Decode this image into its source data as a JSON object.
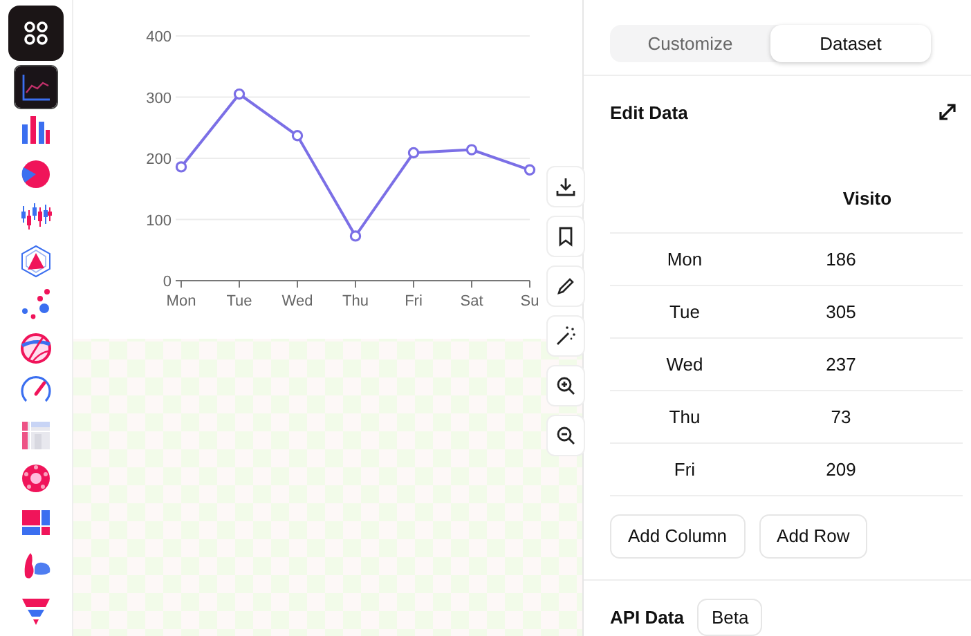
{
  "sidebar": {
    "items": [
      {
        "kind": "line",
        "selected": true
      },
      {
        "kind": "bar",
        "selected": false
      },
      {
        "kind": "pie",
        "selected": false
      },
      {
        "kind": "candlestick",
        "selected": false
      },
      {
        "kind": "radar",
        "selected": false
      },
      {
        "kind": "scatter",
        "selected": false
      },
      {
        "kind": "globe",
        "selected": false
      },
      {
        "kind": "gauge",
        "selected": false
      },
      {
        "kind": "grid",
        "selected": false
      },
      {
        "kind": "flower",
        "selected": false
      },
      {
        "kind": "treemap",
        "selected": false
      },
      {
        "kind": "blob",
        "selected": false
      },
      {
        "kind": "funnel",
        "selected": false
      }
    ]
  },
  "chart": {
    "chart_data": {
      "type": "line",
      "grid": true,
      "categories": [
        "Mon",
        "Tue",
        "Wed",
        "Thu",
        "Fri",
        "Sat",
        "Su"
      ],
      "ylim": [
        0,
        400
      ],
      "yticks": [
        0,
        100,
        200,
        300,
        400
      ],
      "series": [
        {
          "color": "#7b6fe6",
          "marker": "circle",
          "values": [
            186,
            305,
            237,
            73,
            209,
            214,
            181
          ]
        }
      ]
    }
  },
  "toolbar": [
    {
      "kind": "download"
    },
    {
      "kind": "bookmark"
    },
    {
      "kind": "pencil"
    },
    {
      "kind": "wand"
    },
    {
      "kind": "zoom-in"
    },
    {
      "kind": "zoom-out"
    }
  ],
  "panel": {
    "tabs": [
      {
        "label": "Customize",
        "selected": false
      },
      {
        "label": "Dataset",
        "selected": true
      }
    ],
    "title": "Edit Data",
    "table": {
      "columns": [
        "Visito"
      ],
      "rows": [
        [
          "Mon",
          "186"
        ],
        [
          "Tue",
          "305"
        ],
        [
          "Wed",
          "237"
        ],
        [
          "Thu",
          "73"
        ],
        [
          "Fri",
          "209"
        ]
      ]
    },
    "buttons": [
      "Add Column",
      "Add Row"
    ],
    "api": {
      "title": "API Data",
      "badge": "Beta"
    }
  }
}
